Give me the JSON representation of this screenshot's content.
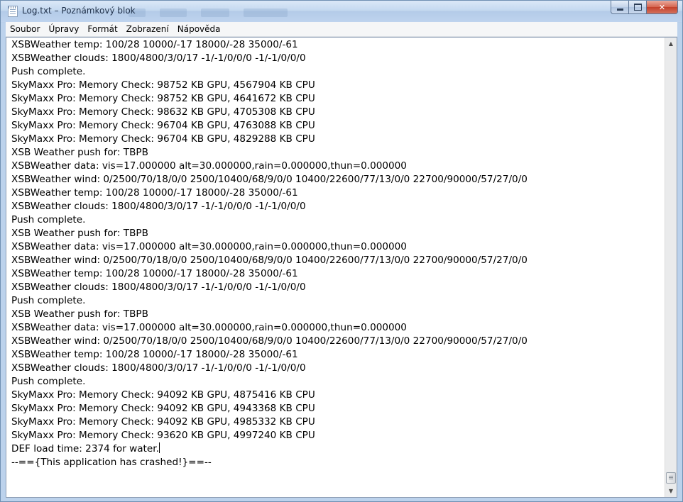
{
  "window": {
    "title": "Log.txt – Poznámkový blok"
  },
  "menu": [
    "Soubor",
    "Úpravy",
    "Formát",
    "Zobrazení",
    "Nápověda"
  ],
  "editor": {
    "lines": [
      "XSBWeather temp: 100/28 10000/-17 18000/-28 35000/-61",
      "XSBWeather clouds: 1800/4800/3/0/17 -1/-1/0/0/0 -1/-1/0/0/0",
      "Push complete.",
      "SkyMaxx Pro: Memory Check: 98752 KB GPU, 4567904 KB CPU",
      "SkyMaxx Pro: Memory Check: 98752 KB GPU, 4641672 KB CPU",
      "SkyMaxx Pro: Memory Check: 98632 KB GPU, 4705308 KB CPU",
      "SkyMaxx Pro: Memory Check: 96704 KB GPU, 4763088 KB CPU",
      "SkyMaxx Pro: Memory Check: 96704 KB GPU, 4829288 KB CPU",
      "XSB Weather push for: TBPB",
      "XSBWeather data: vis=17.000000 alt=30.000000,rain=0.000000,thun=0.000000",
      "XSBWeather wind: 0/2500/70/18/0/0 2500/10400/68/9/0/0 10400/22600/77/13/0/0 22700/90000/57/27/0/0",
      "XSBWeather temp: 100/28 10000/-17 18000/-28 35000/-61",
      "XSBWeather clouds: 1800/4800/3/0/17 -1/-1/0/0/0 -1/-1/0/0/0",
      "Push complete.",
      "XSB Weather push for: TBPB",
      "XSBWeather data: vis=17.000000 alt=30.000000,rain=0.000000,thun=0.000000",
      "XSBWeather wind: 0/2500/70/18/0/0 2500/10400/68/9/0/0 10400/22600/77/13/0/0 22700/90000/57/27/0/0",
      "XSBWeather temp: 100/28 10000/-17 18000/-28 35000/-61",
      "XSBWeather clouds: 1800/4800/3/0/17 -1/-1/0/0/0 -1/-1/0/0/0",
      "Push complete.",
      "XSB Weather push for: TBPB",
      "XSBWeather data: vis=17.000000 alt=30.000000,rain=0.000000,thun=0.000000",
      "XSBWeather wind: 0/2500/70/18/0/0 2500/10400/68/9/0/0 10400/22600/77/13/0/0 22700/90000/57/27/0/0",
      "XSBWeather temp: 100/28 10000/-17 18000/-28 35000/-61",
      "XSBWeather clouds: 1800/4800/3/0/17 -1/-1/0/0/0 -1/-1/0/0/0",
      "Push complete.",
      "SkyMaxx Pro: Memory Check: 94092 KB GPU, 4875416 KB CPU",
      "SkyMaxx Pro: Memory Check: 94092 KB GPU, 4943368 KB CPU",
      "SkyMaxx Pro: Memory Check: 94092 KB GPU, 4985332 KB CPU",
      "SkyMaxx Pro: Memory Check: 93620 KB GPU, 4997240 KB CPU",
      "DEF load time: 2374 for water.",
      "--=={This application has crashed!}==--"
    ]
  }
}
